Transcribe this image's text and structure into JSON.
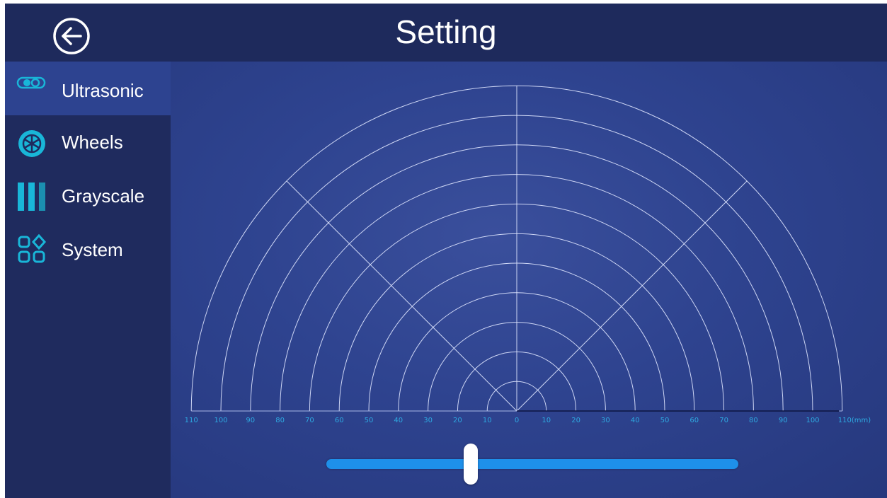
{
  "header": {
    "title": "Setting",
    "back_icon": "back-arrow-circle-icon"
  },
  "sidebar": {
    "items": [
      {
        "label": "Ultrasonic",
        "icon": "ultrasonic-sensor-icon",
        "active": true
      },
      {
        "label": "Wheels",
        "icon": "wheel-icon",
        "active": false
      },
      {
        "label": "Grayscale",
        "icon": "grayscale-bars-icon",
        "active": false
      },
      {
        "label": "System",
        "icon": "system-grid-icon",
        "active": false
      }
    ]
  },
  "radar": {
    "tick_labels_left": [
      "110",
      "100",
      "90",
      "80",
      "70",
      "60",
      "50",
      "40",
      "30",
      "20",
      "10"
    ],
    "center_label": "0",
    "tick_labels_right": [
      "10",
      "20",
      "30",
      "40",
      "50",
      "60",
      "70",
      "80",
      "90",
      "100",
      "110(mm)"
    ]
  },
  "slider": {
    "value_fraction": 0.35
  },
  "colors": {
    "header_bg": "#1e2a5c",
    "sidebar_bg": "#1f2b5e",
    "active_item_bg": "#2d4390",
    "main_bg": "#2e438f",
    "accent_cyan": "#19b6d8",
    "slider_track": "#1e90ea",
    "axis_label": "#2ea8e0"
  }
}
